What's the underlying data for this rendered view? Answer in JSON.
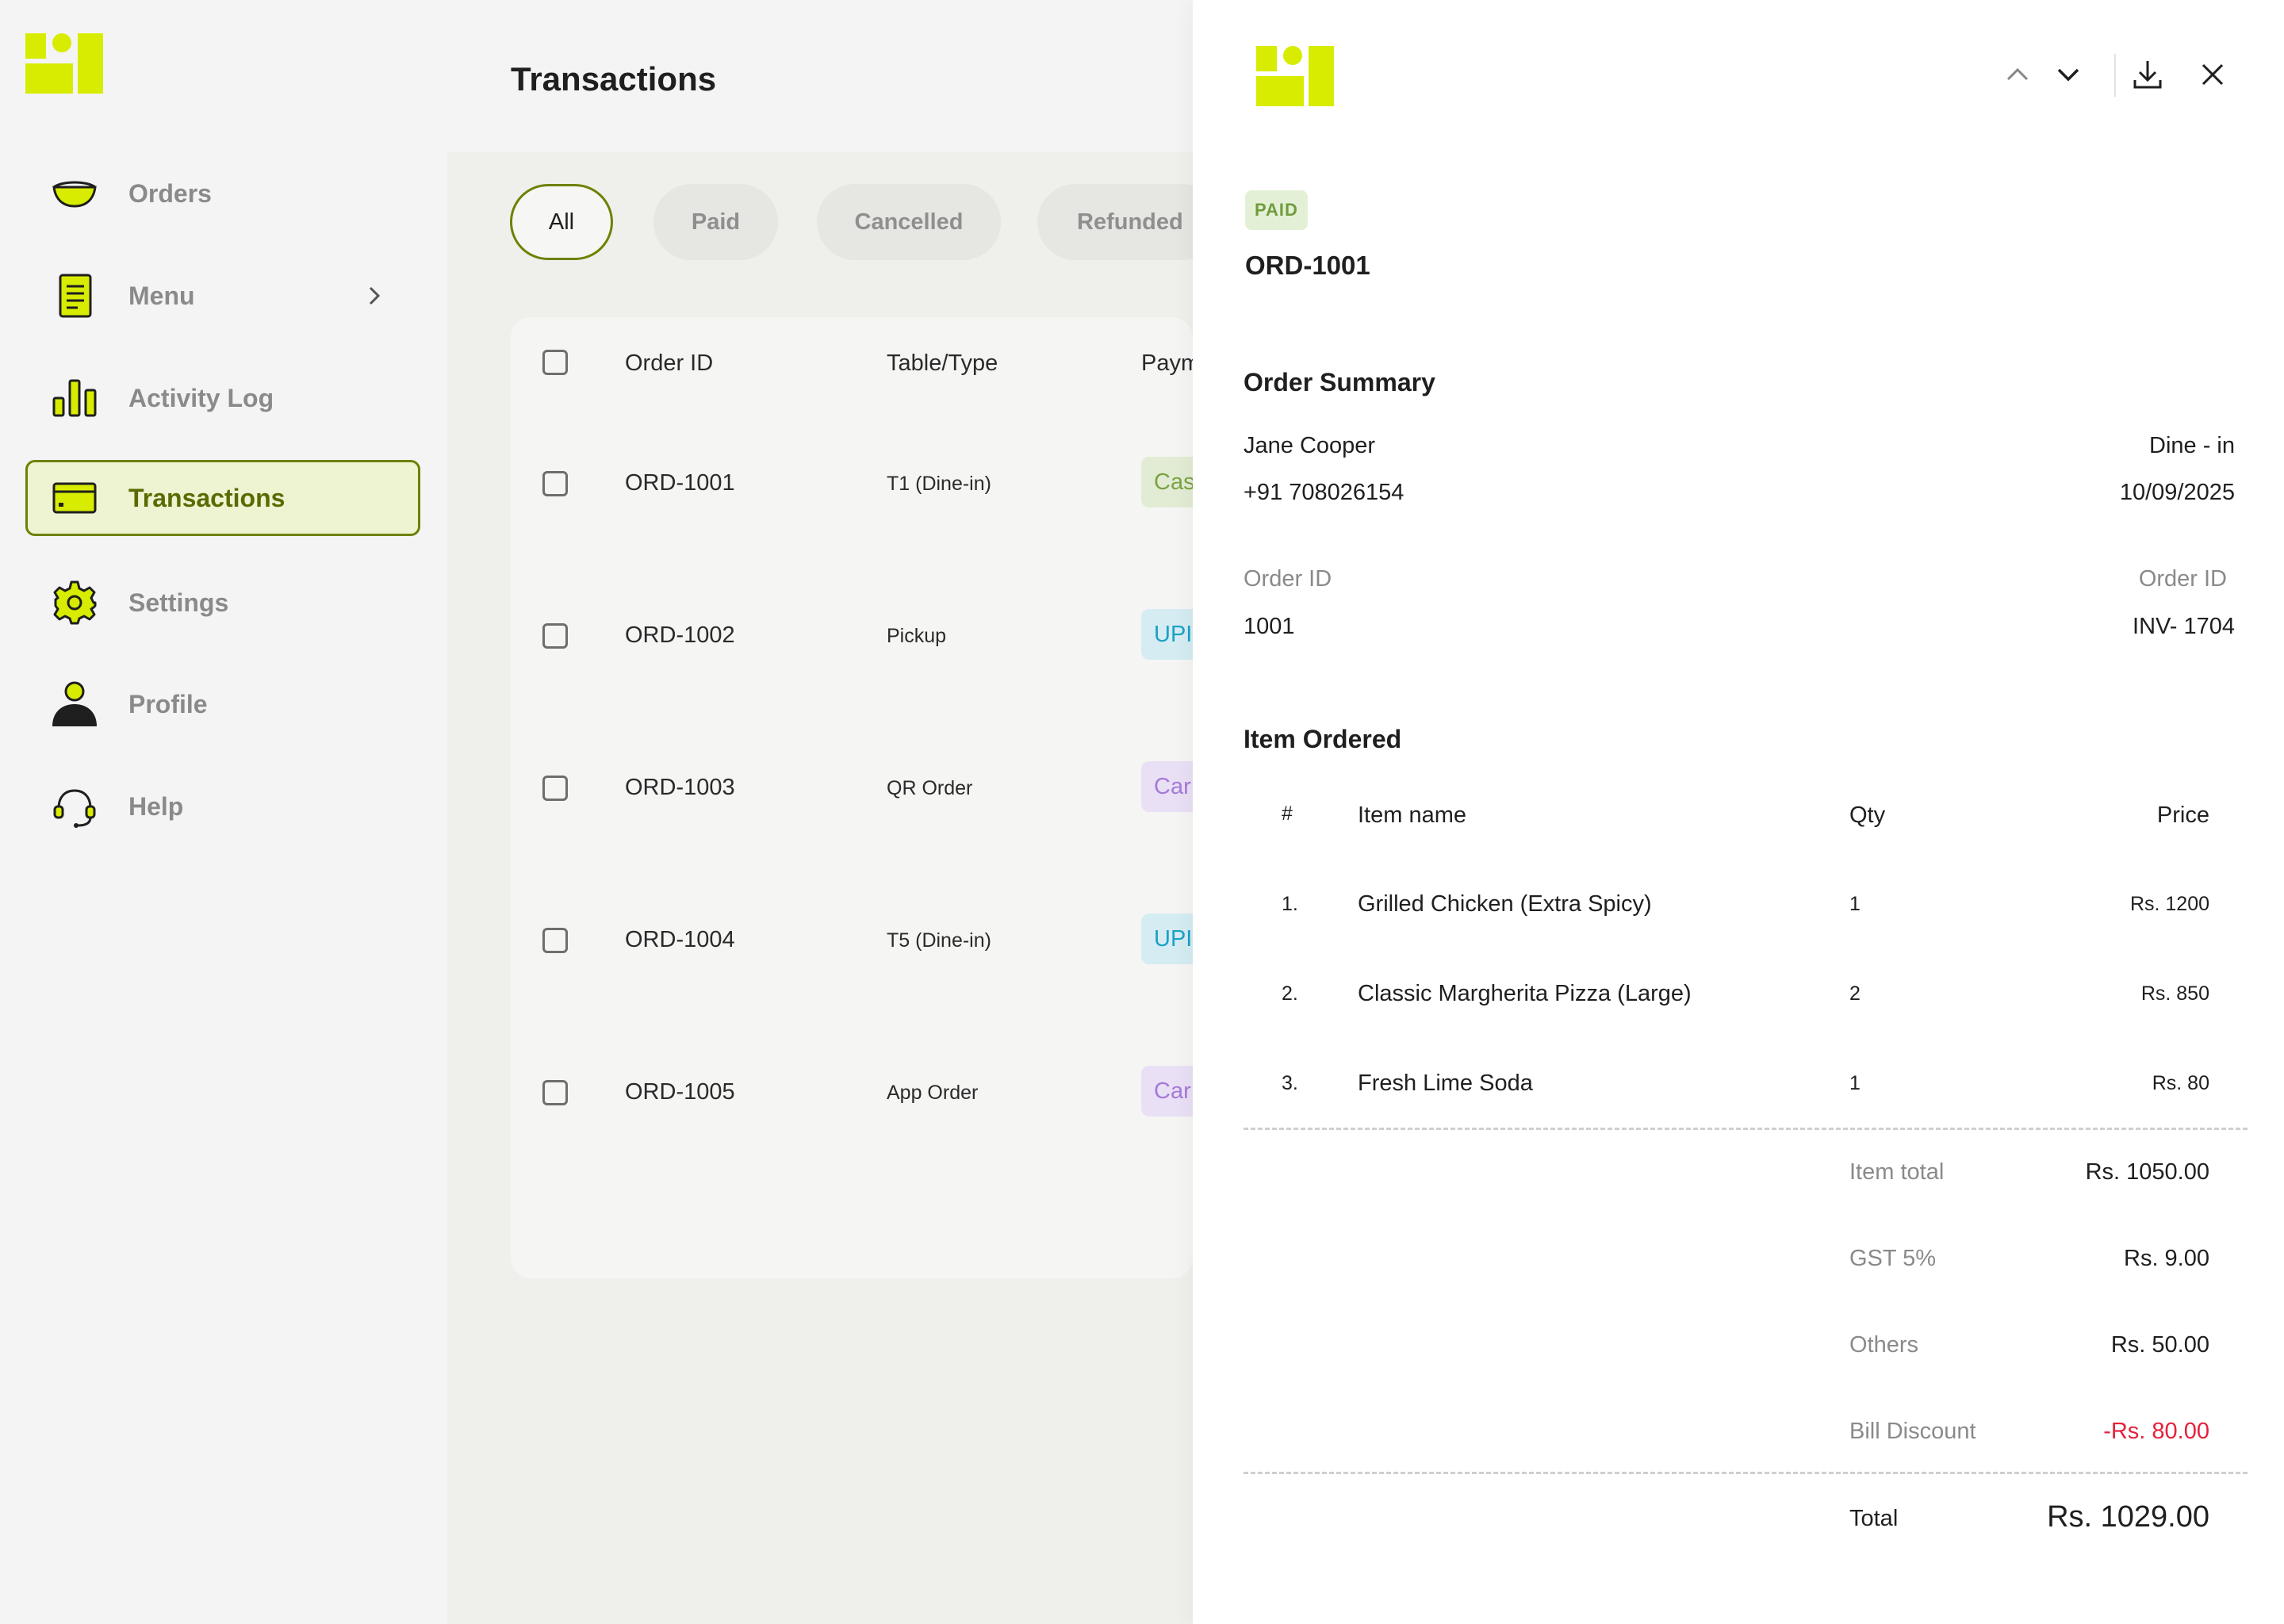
{
  "sidebar": {
    "items": [
      {
        "label": "Orders",
        "icon": "bowl-icon"
      },
      {
        "label": "Menu",
        "icon": "menu-list-icon"
      },
      {
        "label": "Activity Log",
        "icon": "bar-chart-icon"
      },
      {
        "label": "Transactions",
        "icon": "card-icon"
      },
      {
        "label": "Settings",
        "icon": "gear-icon"
      },
      {
        "label": "Profile",
        "icon": "user-icon"
      },
      {
        "label": "Help",
        "icon": "headset-icon"
      }
    ],
    "active": "Transactions"
  },
  "header": {
    "title": "Transactions"
  },
  "filters": [
    "All",
    "Paid",
    "Cancelled",
    "Refunded"
  ],
  "table": {
    "columns": [
      "Order ID",
      "Table/Type",
      "Paym"
    ],
    "rows": [
      {
        "id": "ORD-1001",
        "type": "T1 (Dine-in)",
        "payment": "Cas"
      },
      {
        "id": "ORD-1002",
        "type": "Pickup",
        "payment": "UPI"
      },
      {
        "id": "ORD-1003",
        "type": "QR Order",
        "payment": "Car"
      },
      {
        "id": "ORD-1004",
        "type": "T5 (Dine-in)",
        "payment": "UPI"
      },
      {
        "id": "ORD-1005",
        "type": "App Order",
        "payment": "Car"
      }
    ]
  },
  "drawer": {
    "status": "PAID",
    "order_id": "ORD-1001",
    "summary_title": "Order Summary",
    "customer_name": "Jane Cooper",
    "order_type": "Dine - in",
    "phone": "+91 708026154",
    "date": "10/09/2025",
    "order_id_label": "Order ID",
    "order_id_value": "1001",
    "invoice_label": "Order ID",
    "invoice_value": "INV- 1704",
    "items_title": "Item Ordered",
    "item_columns": {
      "num": "#",
      "name": "Item name",
      "qty": "Qty",
      "price": "Price"
    },
    "items": [
      {
        "num": "1.",
        "name": "Grilled Chicken (Extra Spicy)",
        "qty": "1",
        "price": "Rs. 1200"
      },
      {
        "num": "2.",
        "name": "Classic Margherita Pizza (Large)",
        "qty": "2",
        "price": "Rs. 850"
      },
      {
        "num": "3.",
        "name": "Fresh Lime Soda",
        "qty": "1",
        "price": "Rs. 80"
      }
    ],
    "totals": {
      "item_total_label": "Item total",
      "item_total": "Rs. 1050.00",
      "gst_label": "GST 5%",
      "gst": "Rs. 9.00",
      "others_label": "Others",
      "others": "Rs. 50.00",
      "discount_label": "Bill Discount",
      "discount": "-Rs. 80.00",
      "total_label": "Total",
      "total": "Rs. 1029.00"
    }
  },
  "colors": {
    "brand": "#d7ec00",
    "accent_border": "#6f8000",
    "discount": "#e5213a"
  }
}
